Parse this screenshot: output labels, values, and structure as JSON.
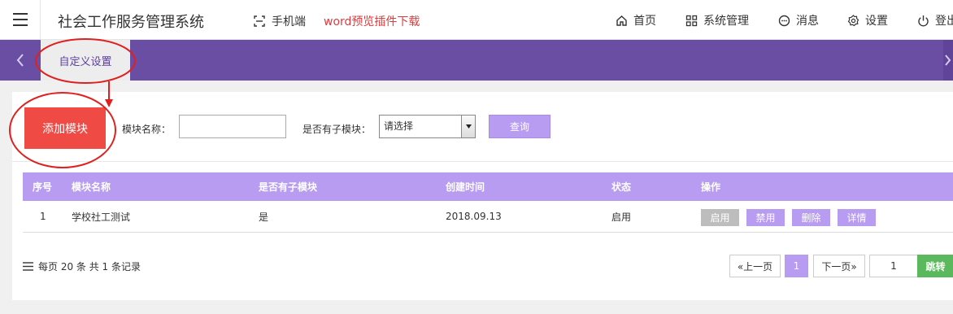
{
  "header": {
    "app_title": "社会工作服务管理系统",
    "mobile_label": "手机端",
    "plugin_link": "word预览插件下载",
    "nav": {
      "home": "首页",
      "system": "系统管理",
      "messages": "消息",
      "settings": "设置",
      "logout": "登出"
    }
  },
  "tabs": {
    "active": "自定义设置"
  },
  "search": {
    "add_button": "添加模块",
    "name_label": "模块名称：",
    "name_value": "",
    "has_child_label": "是否有子模块：",
    "has_child_selected": "请选择",
    "query_button": "查询"
  },
  "table": {
    "headers": [
      "序号",
      "模块名称",
      "是否有子模块",
      "创建时间",
      "状态",
      "操作"
    ],
    "rows": [
      {
        "index": "1",
        "name": "学校社工测试",
        "has_child": "是",
        "created": "2018.09.13",
        "status": "启用",
        "actions": [
          "启用",
          "禁用",
          "删除",
          "详情"
        ]
      }
    ]
  },
  "footer": {
    "per_page_text": "每页 20 条 共 1 条记录",
    "prev": "«上一页",
    "current_page": "1",
    "next": "下一页»",
    "jump_value": "1",
    "jump_button": "跳转"
  },
  "colors": {
    "purple_bar": "#6a4ea4",
    "accent_purple": "#b79cf1",
    "add_red": "#f04a45",
    "annotation_red": "#e02020",
    "jump_green": "#5cb85c",
    "disabled_gray": "#bdbdbd"
  }
}
